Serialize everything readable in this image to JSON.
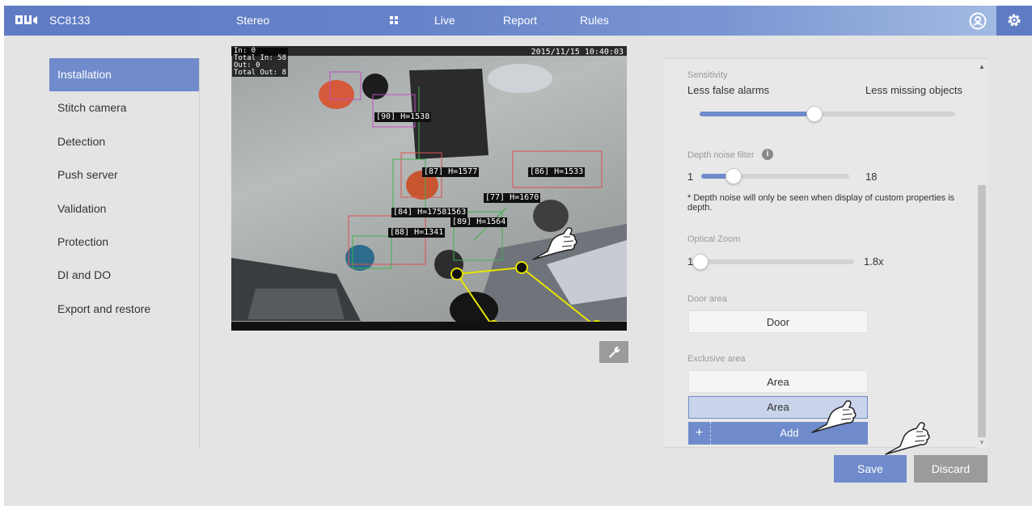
{
  "header": {
    "model": "SC8133",
    "mode": "Stereo",
    "nav": [
      "Live",
      "Report",
      "Rules"
    ],
    "icons": [
      "vivotek-logo-icon",
      "grid-icon",
      "account-icon",
      "gear-icon"
    ]
  },
  "sidebar": {
    "items": [
      {
        "label": "Installation",
        "active": true
      },
      {
        "label": "Stitch camera"
      },
      {
        "label": "Detection"
      },
      {
        "label": "Push server"
      },
      {
        "label": "Validation"
      },
      {
        "label": "Protection"
      },
      {
        "label": "DI and DO"
      },
      {
        "label": "Export and restore"
      }
    ]
  },
  "video": {
    "timestamp": "2015/11/15 10:40:03",
    "counters": [
      "In: 0",
      "Total In: 58",
      "Out: 0",
      "Total Out: 8"
    ],
    "tags": [
      "[90] H=1538",
      "[87] H=1577",
      "[86] H=1533",
      "[77] H=1670",
      "[84] H=17581563",
      "[89] H=1564",
      "[88] H=1341"
    ]
  },
  "panel": {
    "sensitivity": {
      "label": "Sensitivity",
      "min_label": "Less false alarms",
      "max_label": "Less missing objects",
      "level": 0.45
    },
    "depth_noise": {
      "label": "Depth noise filter",
      "min": "1",
      "max": "18",
      "value_fraction": 0.22,
      "note": "* Depth noise will only be seen when display of custom properties is depth."
    },
    "optical_zoom": {
      "label": "Optical Zoom",
      "min": "1x",
      "max": "1.8x",
      "value_fraction": 0.0
    },
    "door_area": {
      "label": "Door area",
      "button": "Door"
    },
    "exclusive_area": {
      "label": "Exclusive area",
      "areas": [
        "Area",
        "Area"
      ],
      "add_label": "Add"
    }
  },
  "actions": {
    "save": "Save",
    "discard": "Discard"
  }
}
